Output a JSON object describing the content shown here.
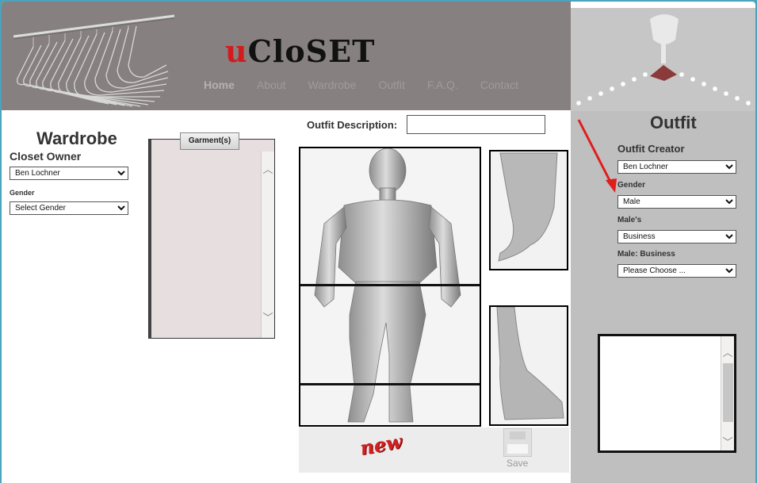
{
  "header": {
    "logo_u": "u",
    "logo_rest": "CloSET",
    "nav": [
      "Home",
      "About",
      "Wardrobe",
      "Outfit",
      "F.A.Q.",
      "Contact"
    ]
  },
  "wardrobe": {
    "title": "Wardrobe",
    "owner_label": "Closet Owner",
    "owner_value": "Ben Lochner",
    "gender_label": "Gender",
    "gender_value": "Select Gender",
    "garments_button": "Garment(s)"
  },
  "outfit_area": {
    "description_label": "Outfit Description:",
    "description_value": "",
    "new_label": "new",
    "save_label": "Save"
  },
  "outfit_panel": {
    "title": "Outfit",
    "creator_label": "Outfit Creator",
    "creator_value": "Ben Lochner",
    "gender_label": "Gender",
    "gender_value": "Male",
    "category_label": "Male's",
    "category_value": "Business",
    "sub_label": "Male: Business",
    "sub_value": "Please Choose ..."
  },
  "colors": {
    "header_bg": "#878080",
    "panel_bg": "#bfbfbf",
    "logo_accent": "#d21b1b",
    "annotation_arrow": "#e11d1d"
  }
}
